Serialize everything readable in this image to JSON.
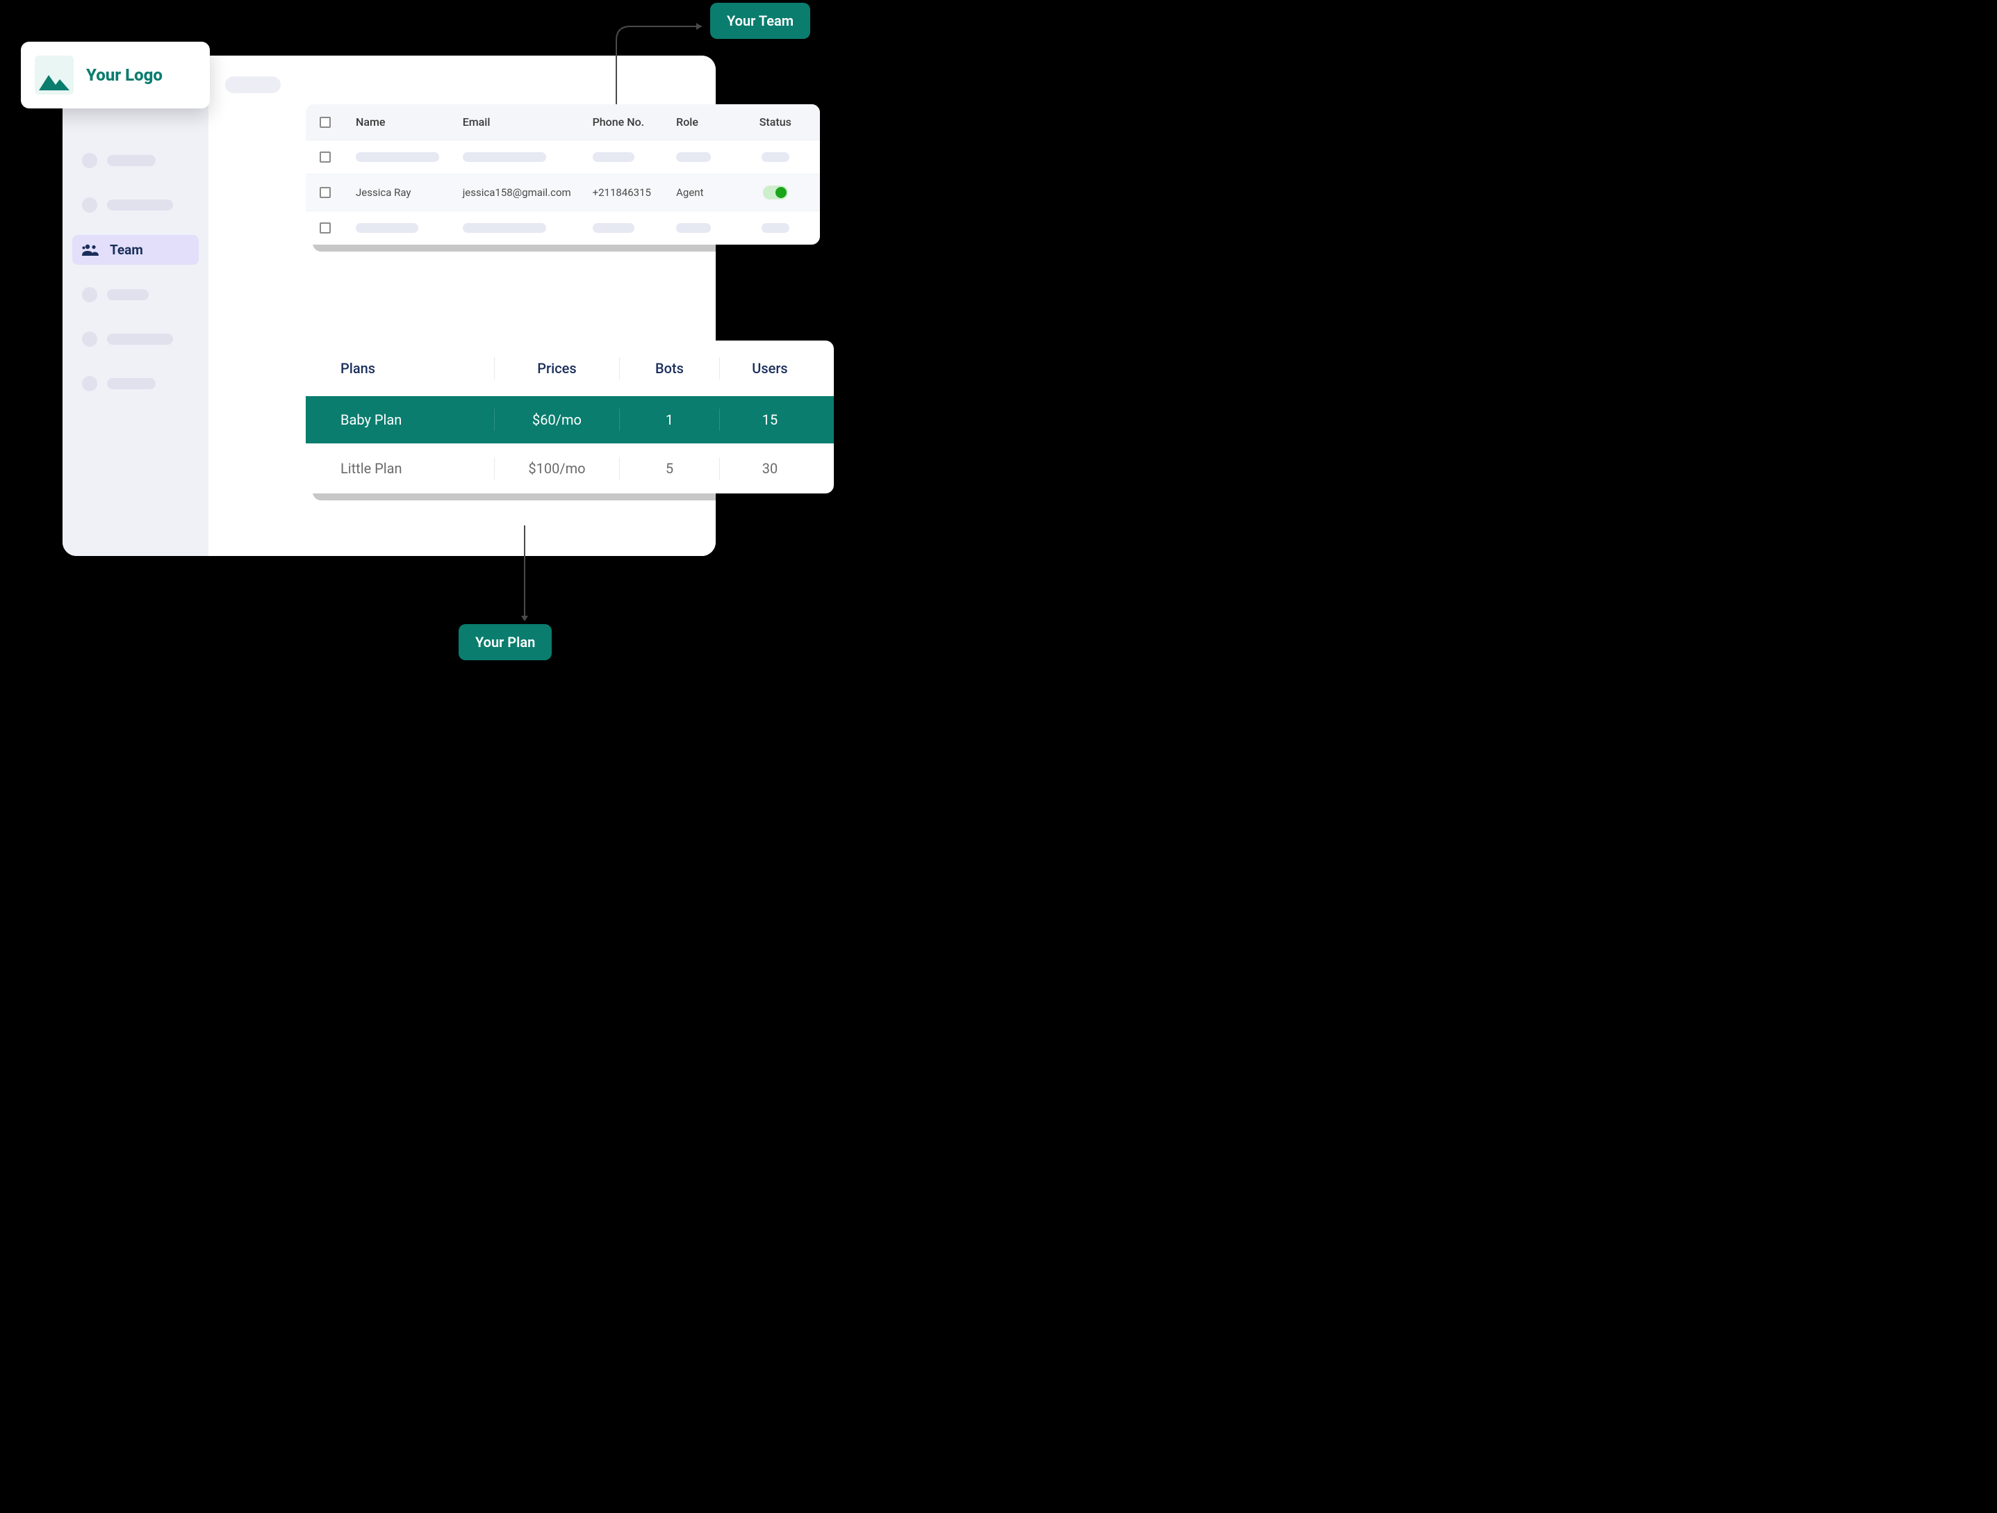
{
  "logo": {
    "label": "Your Logo"
  },
  "sidebar": {
    "active_label": "Team"
  },
  "team_table": {
    "headers": {
      "name": "Name",
      "email": "Email",
      "phone": "Phone No.",
      "role": "Role",
      "status": "Status"
    },
    "row": {
      "name": "Jessica Ray",
      "email": "jessica158@gmail.com",
      "phone": "+211846315",
      "role": "Agent",
      "status_on": true
    }
  },
  "plans_table": {
    "headers": {
      "plans": "Plans",
      "prices": "Prices",
      "bots": "Bots",
      "users": "Users"
    },
    "rows": [
      {
        "plan": "Baby Plan",
        "price": "$60/mo",
        "bots": "1",
        "users": "15",
        "selected": true
      },
      {
        "plan": "Little Plan",
        "price": "$100/mo",
        "bots": "5",
        "users": "30",
        "selected": false
      }
    ]
  },
  "callouts": {
    "team": "Your Team",
    "plan": "Your Plan"
  }
}
